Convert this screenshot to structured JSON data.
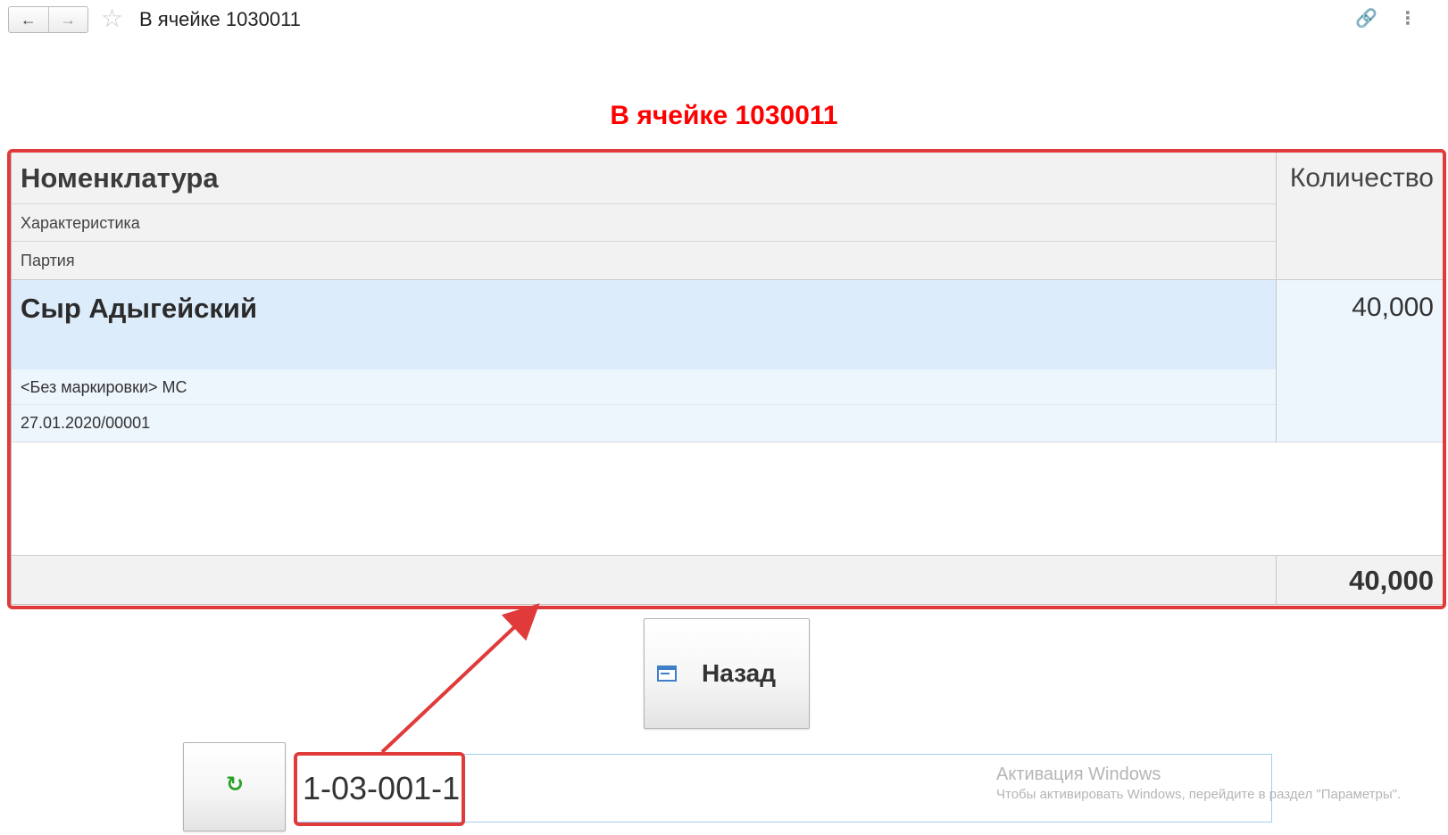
{
  "window": {
    "title": "В ячейке 1030011",
    "back_glyph": "🡐",
    "forward_glyph": "🡒",
    "icons": [
      "arrow-left-icon",
      "arrow-right-icon",
      "star-icon",
      "link-icon",
      "more-vertical-icon"
    ]
  },
  "heading": "В ячейке 1030011",
  "table": {
    "columns": {
      "name": "Номенклатура",
      "characteristic": "Характеристика",
      "batch": "Партия",
      "quantity": "Количество"
    },
    "rows": [
      {
        "name": "Сыр Адыгейский",
        "characteristic": "<Без маркировки> МС",
        "batch": "27.01.2020/00001",
        "quantity": "40,000"
      }
    ],
    "total_quantity": "40,000"
  },
  "buttons": {
    "back_label": "Назад",
    "refresh_icon": "refresh-icon"
  },
  "cell_input": {
    "value": "1-03-001-1"
  },
  "watermark": {
    "title": "Активация Windows",
    "text": "Чтобы активировать Windows, перейдите в раздел \"Параметры\"."
  },
  "colors": {
    "heading": "#ff0000",
    "annotation": "#e03a3a",
    "selected_row": "#dcecfb",
    "header_bg": "#f2f2f2"
  }
}
